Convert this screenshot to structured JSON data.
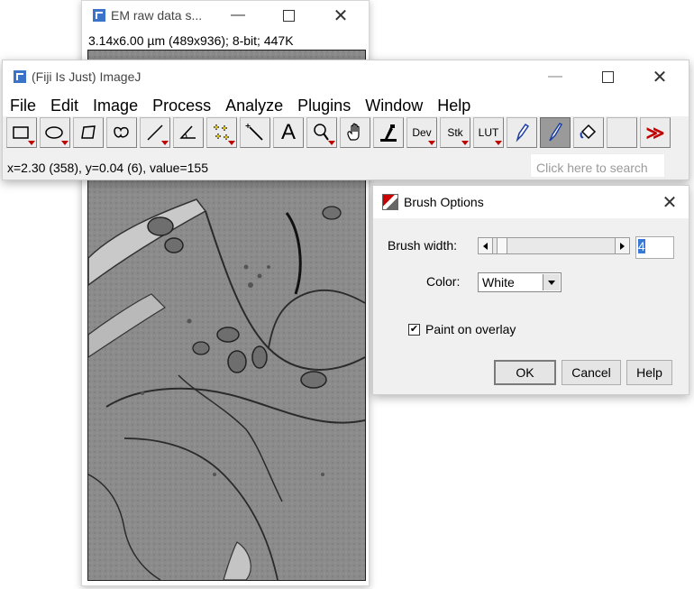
{
  "em_window": {
    "title": "EM raw data s...",
    "info": "3.14x6.00 µm (489x936); 8-bit; 447K"
  },
  "imagej": {
    "title": "(Fiji Is Just) ImageJ",
    "menus": [
      "File",
      "Edit",
      "Image",
      "Process",
      "Analyze",
      "Plugins",
      "Window",
      "Help"
    ],
    "tools": [
      {
        "name": "rectangle-tool-icon",
        "label": ""
      },
      {
        "name": "oval-tool-icon",
        "label": ""
      },
      {
        "name": "polygon-tool-icon",
        "label": ""
      },
      {
        "name": "freehand-tool-icon",
        "label": ""
      },
      {
        "name": "line-tool-icon",
        "label": ""
      },
      {
        "name": "angle-tool-icon",
        "label": ""
      },
      {
        "name": "multipoint-tool-icon",
        "label": ""
      },
      {
        "name": "wand-tool-icon",
        "label": ""
      },
      {
        "name": "text-tool-icon",
        "label": "A"
      },
      {
        "name": "zoom-tool-icon",
        "label": ""
      },
      {
        "name": "hand-tool-icon",
        "label": ""
      },
      {
        "name": "dropper-tool-icon",
        "label": ""
      },
      {
        "name": "dev-tool-icon",
        "label": "Dev"
      },
      {
        "name": "stk-tool-icon",
        "label": "Stk"
      },
      {
        "name": "lut-tool-icon",
        "label": "LUT"
      },
      {
        "name": "pencil-tool-icon",
        "label": ""
      },
      {
        "name": "brush-tool-icon",
        "label": ""
      },
      {
        "name": "flood-fill-tool-icon",
        "label": ""
      },
      {
        "name": "empty-tool-slot",
        "label": ""
      },
      {
        "name": "more-tools-icon",
        "label": "≫"
      }
    ],
    "status": "x=2.30 (358), y=0.04 (6), value=155",
    "search_placeholder": "Click here to search"
  },
  "brush_options": {
    "title": "Brush Options",
    "brush_width_label": "Brush width:",
    "brush_width_value": "4",
    "color_label": "Color:",
    "color_value": "White",
    "paint_on_overlay_label": "Paint on overlay",
    "paint_on_overlay_checked": true,
    "ok_label": "OK",
    "cancel_label": "Cancel",
    "help_label": "Help"
  }
}
